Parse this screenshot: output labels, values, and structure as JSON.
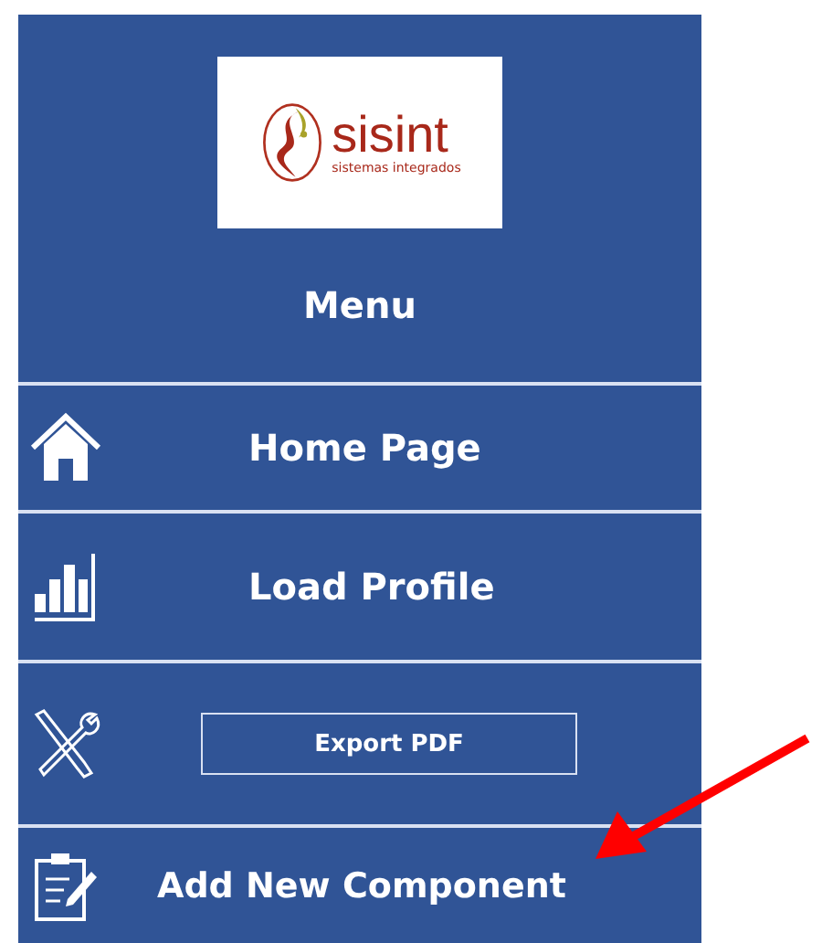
{
  "logo": {
    "name": "sisint",
    "tagline": "sistemas integrados"
  },
  "menu": {
    "title": "Menu",
    "items": [
      {
        "kind": "link",
        "label": "Home Page"
      },
      {
        "kind": "link",
        "label": "Load Profile"
      },
      {
        "kind": "button",
        "label": "Export PDF"
      },
      {
        "kind": "link",
        "label": "Add New Component"
      }
    ]
  }
}
